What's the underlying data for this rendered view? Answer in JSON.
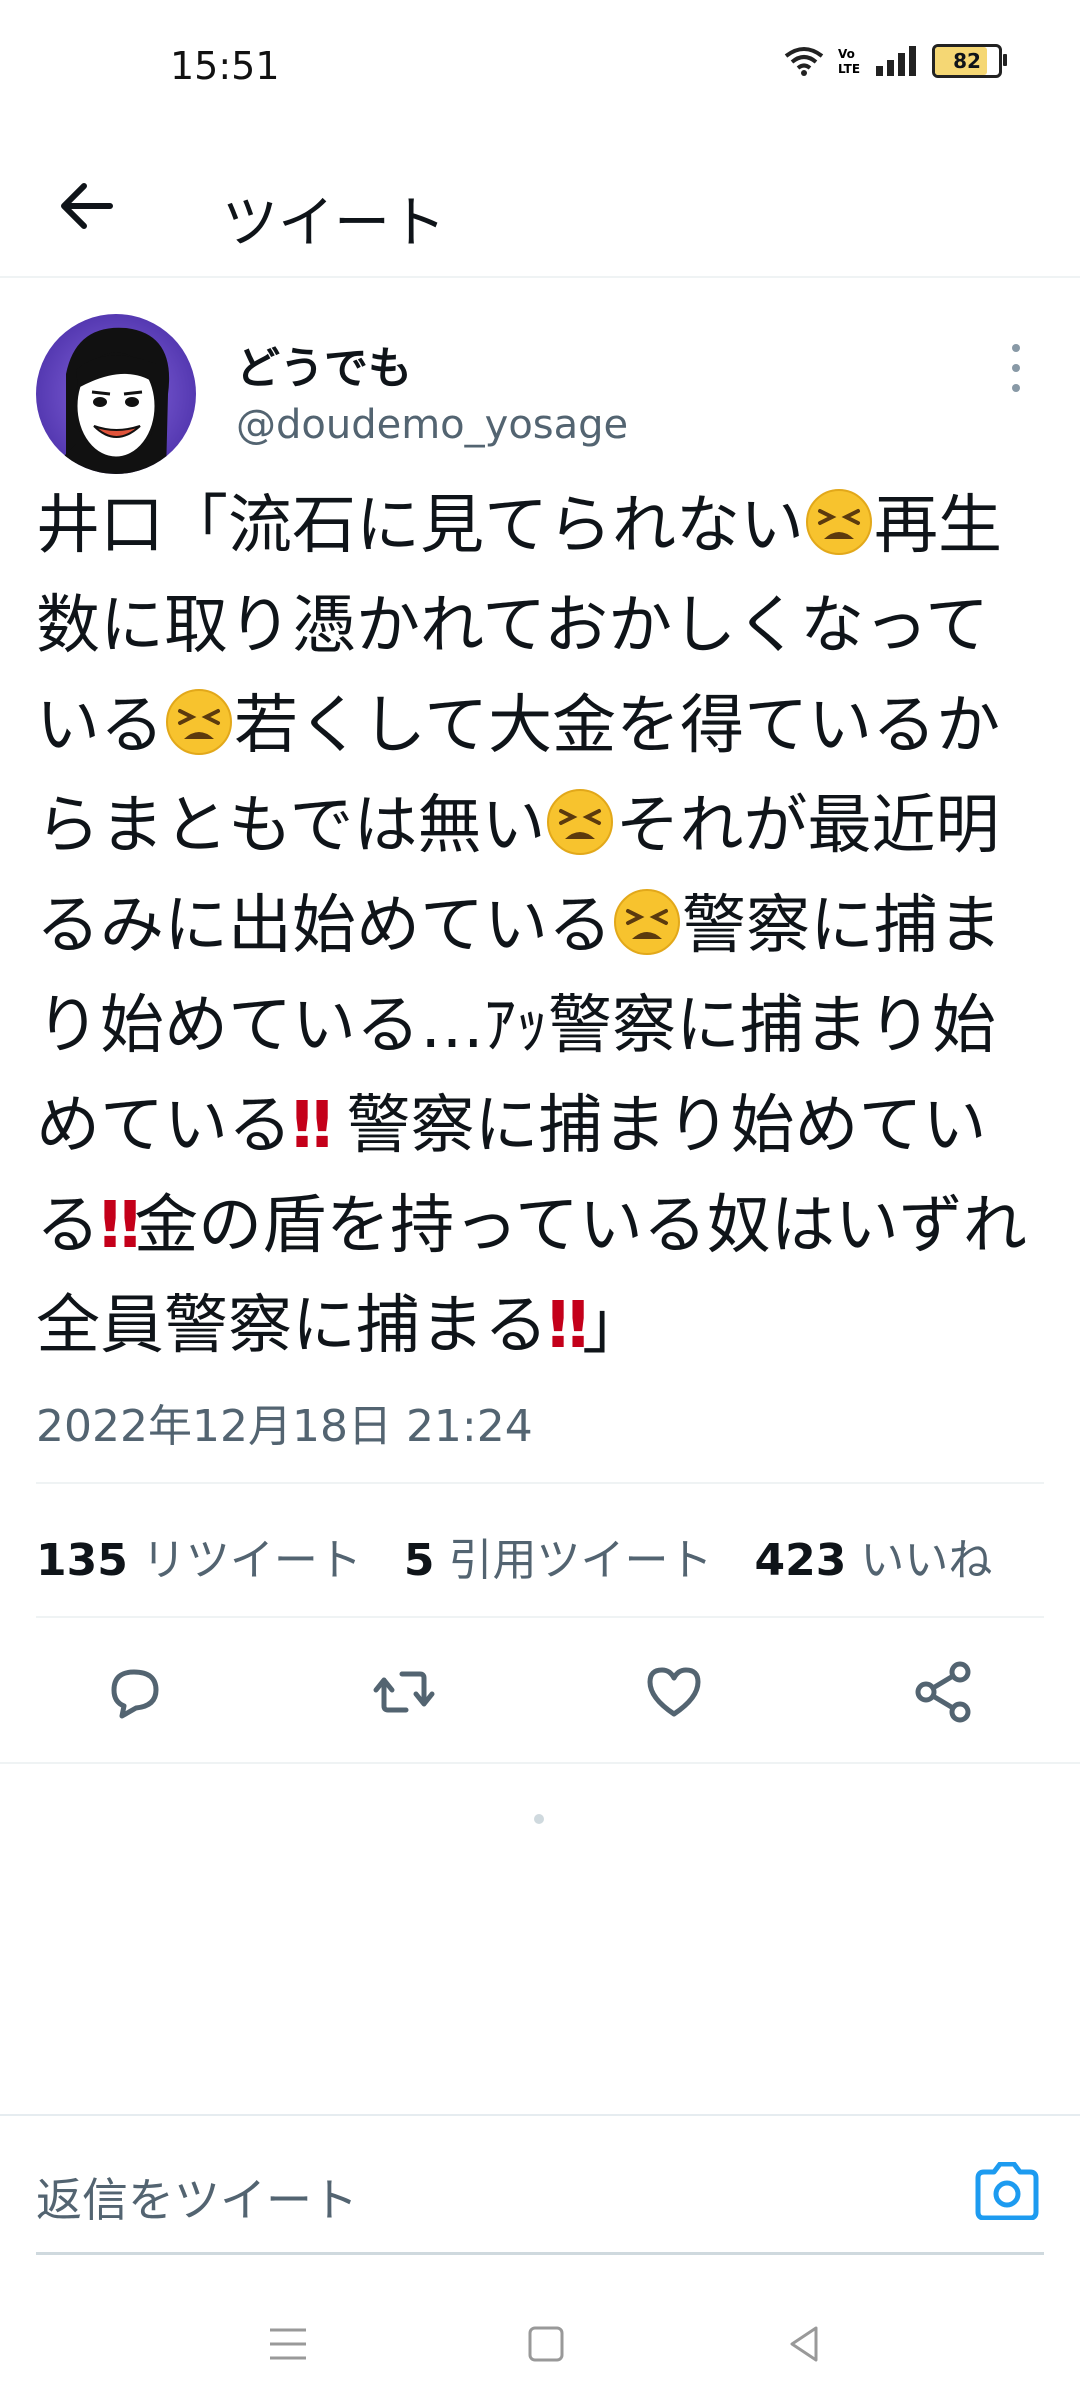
{
  "status_bar": {
    "time": "15:51",
    "battery": "82",
    "battery_level": 0.82
  },
  "header": {
    "title": "ツイート"
  },
  "tweet": {
    "display_name": "どうでも",
    "handle": "@doudemo_yosage",
    "text_lines": [
      "井口「流石に見てられない",
      "再生数に取り憑かれておかしくなっている",
      "若くして大金を得ているからまともでは無い",
      "それが最近明るみに出始めている",
      "警察に捕まり始めている…ｱｯ警察に捕まり始めている",
      "警察に捕まり始めている",
      "金の盾を持っている奴はいずれ全員警察に捕まる",
      "」"
    ],
    "timestamp": "2022年12月18日 21:24",
    "stats": {
      "retweets_count": "135",
      "retweets_label": "リツイート",
      "quotes_count": "5",
      "quotes_label": "引用ツイート",
      "likes_count": "423",
      "likes_label": "いいね"
    }
  },
  "reply": {
    "placeholder": "返信をツイート"
  },
  "icons": [
    "back-arrow-icon",
    "more-vertical-icon",
    "reply-icon",
    "retweet-icon",
    "like-icon",
    "share-icon",
    "camera-icon",
    "menu-icon",
    "home-icon",
    "back-icon"
  ],
  "colors": {
    "accent": "#1d9bf0",
    "text": "#0f1419",
    "secondary": "#536471",
    "exclaim": "#c4001a"
  }
}
